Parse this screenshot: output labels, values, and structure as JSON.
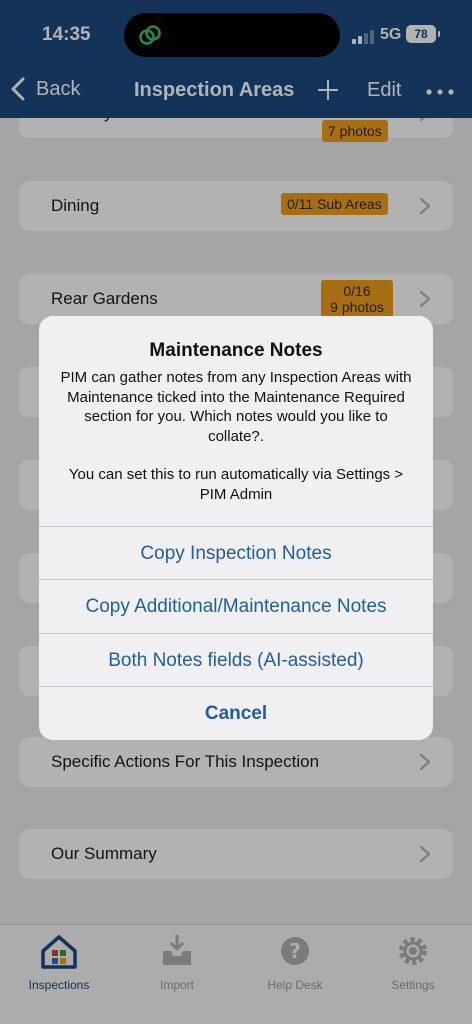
{
  "status_bar": {
    "time": "14:35",
    "network": "5G",
    "battery": "78"
  },
  "nav": {
    "back_label": "Back",
    "title": "Inspection Areas",
    "edit_label": "Edit"
  },
  "list": {
    "laundry": {
      "label": "Laundry",
      "badge": "7 photos"
    },
    "dining": {
      "label": "Dining",
      "badge": "0/11 Sub Areas"
    },
    "rear_gardens": {
      "label": "Rear Gardens",
      "badge_line1": "0/16",
      "badge_line2": "9 photos"
    },
    "specific_actions": {
      "label": "Specific Actions For This Inspection"
    },
    "our_summary": {
      "label": "Our Summary"
    }
  },
  "alert": {
    "title": "Maintenance Notes",
    "message_1": "PIM can gather notes from any Inspection Areas with Maintenance ticked into the Maintenance Required section for you. Which notes would you like to collate?.",
    "message_2": "You can set this to run automatically via Settings > PIM Admin",
    "buttons": [
      "Copy Inspection Notes",
      "Copy Additional/Maintenance Notes",
      "Both Notes fields (AI-assisted)",
      "Cancel"
    ]
  },
  "tabs": [
    {
      "label": "Inspections",
      "icon": "home-icon",
      "active": true
    },
    {
      "label": "Import",
      "icon": "inbox-download-icon"
    },
    {
      "label": "Help Desk",
      "icon": "question-icon"
    },
    {
      "label": "Settings",
      "icon": "gear-icon"
    }
  ],
  "colors": {
    "header": "#1c4a7e",
    "badge": "#f0a018",
    "link": "#1f5f9a",
    "island_icon": "#34c759"
  }
}
